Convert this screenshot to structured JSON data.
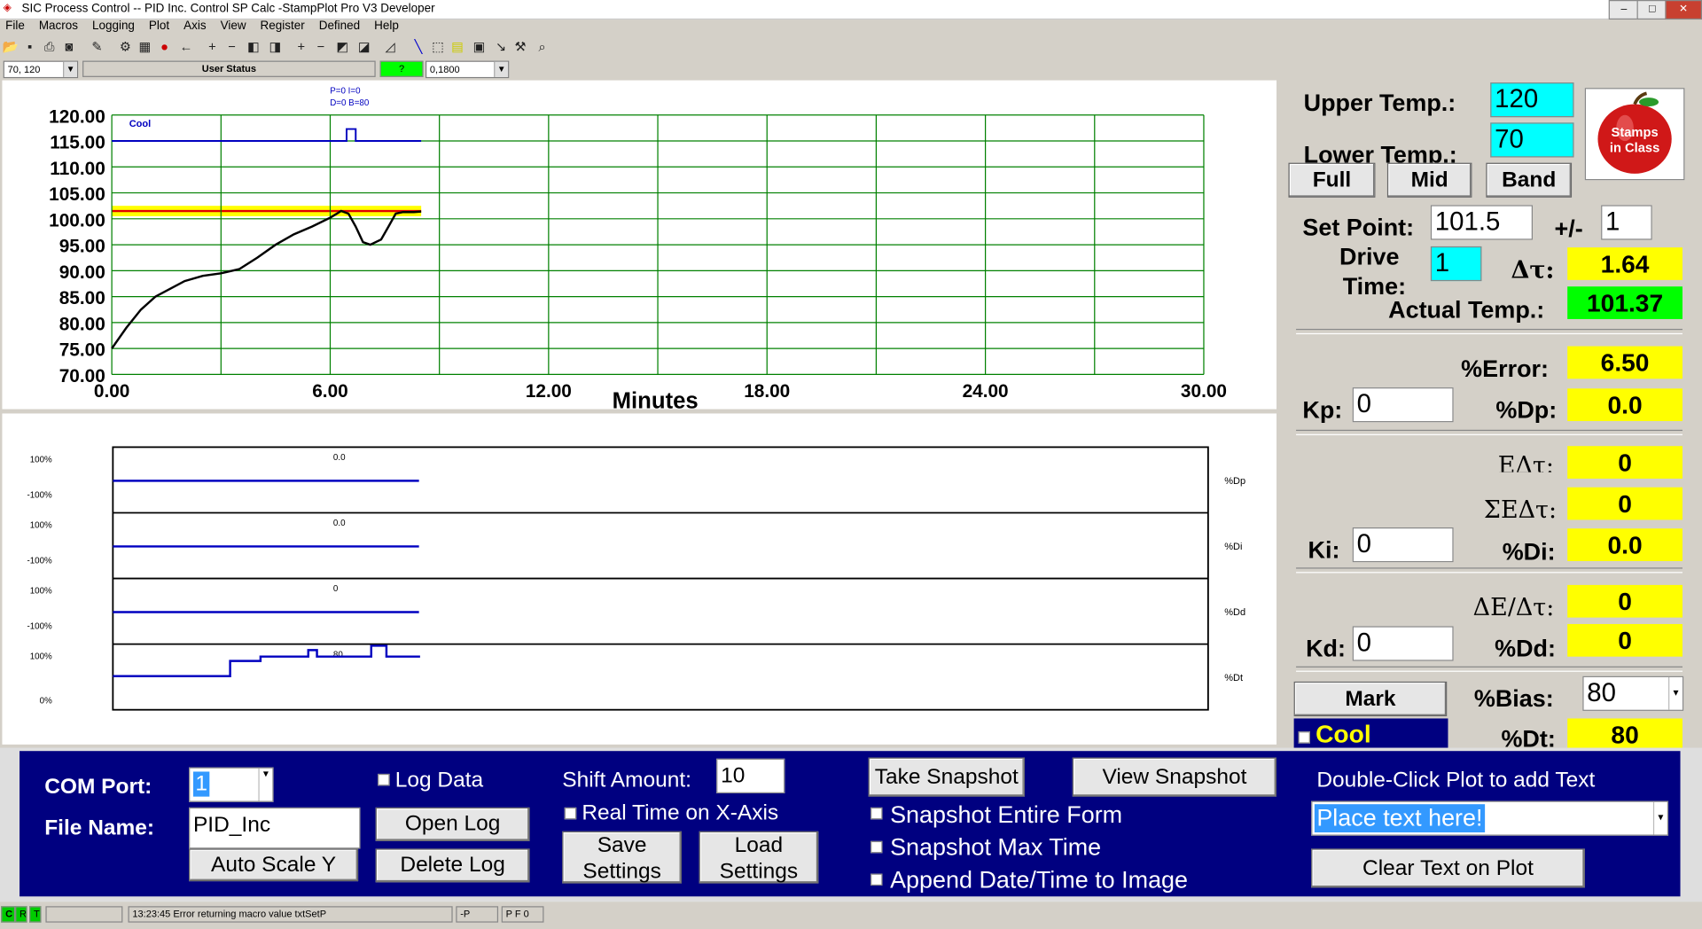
{
  "window": {
    "title": "SIC Process Control -- PID Inc. Control SP Calc -StampPlot Pro V3 Developer"
  },
  "menu": [
    "File",
    "Macros",
    "Logging",
    "Plot",
    "Axis",
    "View",
    "Register",
    "Defined",
    "Help"
  ],
  "toolbar2": {
    "coords": "70, 120",
    "user_status": "User Status",
    "indicator": "?",
    "zoom_value": "0,1800"
  },
  "colors": {
    "panel_blue": "#000080",
    "cyan": "#00ffff",
    "yellow": "#ffff00",
    "green": "#00ff00",
    "grid": "#008000"
  },
  "top_plot": {
    "legend_pid": "P=0 I=0",
    "legend_db": "D=0 B=80",
    "cool_label": "Cool",
    "xlabel": "Minutes"
  },
  "bottom_plot": {
    "rows": [
      {
        "top_pct": "100%",
        "bot_pct": "-100%",
        "value": "0.0",
        "name": "%Dp"
      },
      {
        "top_pct": "100%",
        "bot_pct": "-100%",
        "value": "0.0",
        "name": "%Di"
      },
      {
        "top_pct": "100%",
        "bot_pct": "-100%",
        "value": "0",
        "name": "%Dd"
      },
      {
        "top_pct": "100%",
        "bot_pct": "0%",
        "value": "80",
        "name": "%Dt"
      }
    ]
  },
  "chart_data": {
    "type": "line",
    "title": "",
    "xlabel": "Minutes",
    "ylabel": "",
    "xlim": [
      0,
      30
    ],
    "ylim": [
      70,
      120
    ],
    "x_ticks": [
      "0.00",
      "6.00",
      "12.00",
      "18.00",
      "24.00",
      "30.00"
    ],
    "y_ticks": [
      "120.00",
      "115.00",
      "110.00",
      "105.00",
      "100.00",
      "95.00",
      "90.00",
      "85.00",
      "80.00",
      "75.00",
      "70.00"
    ],
    "grid": true,
    "band": {
      "center": 101.5,
      "low": 100.5,
      "high": 102.5
    },
    "series": [
      {
        "name": "Temp",
        "color": "#000000",
        "x": [
          0,
          0.4,
          0.8,
          1.2,
          1.6,
          2.0,
          2.5,
          3.0,
          3.5,
          4.0,
          4.5,
          5.0,
          5.5,
          6.0,
          6.3,
          6.5,
          6.7,
          6.9,
          7.1,
          7.4,
          7.6,
          7.8,
          8.0,
          8.3,
          8.5
        ],
        "y": [
          75,
          79,
          82.5,
          85,
          86.5,
          88,
          89,
          89.5,
          90.3,
          92.5,
          95,
          97,
          98.5,
          100.2,
          101.5,
          101,
          98.5,
          95.5,
          95,
          96,
          98.5,
          101,
          101.3,
          101.3,
          101.4
        ]
      },
      {
        "name": "Cool",
        "color": "#0000c0",
        "x": [
          0,
          6.45,
          6.45,
          6.7,
          6.7,
          8.5
        ],
        "y": [
          115,
          115,
          117.3,
          117.3,
          115,
          115
        ]
      }
    ]
  },
  "panel": {
    "upper_temp_label": "Upper Temp.:",
    "upper_temp": "120",
    "lower_temp_label": "Lower Temp.:",
    "lower_temp": "70",
    "btn_full": "Full",
    "btn_mid": "Mid",
    "btn_band": "Band",
    "logo_text": "Stamps in Class",
    "set_point_label": "Set Point:",
    "set_point": "101.5",
    "pm_label": "+/-",
    "pm_value": "1",
    "drive_label": "Drive",
    "time_label": "Time:",
    "drive_time": "1",
    "dt_label": "Δτ:",
    "dt_value": "1.64",
    "actual_label": "Actual Temp.:",
    "actual_value": "101.37",
    "error_label": "%Error:",
    "error_value": "6.50",
    "kp_label": "Kp:",
    "kp_value": "0",
    "dp_label": "%Dp:",
    "dp_value": "0.0",
    "edt_label": "EΔτ:",
    "edt_value": "0",
    "sedt_label": "ΣEΔτ:",
    "sedt_value": "0",
    "ki_label": "Ki:",
    "ki_value": "0",
    "di_label": "%Di:",
    "di_value": "0.0",
    "dedt_label": "ΔE/Δτ:",
    "dedt_value": "0",
    "kd_label": "Kd:",
    "kd_value": "0",
    "dd_label": "%Dd:",
    "dd_value": "0",
    "mark_btn": "Mark",
    "bias_label": "%Bias:",
    "bias_value": "80",
    "cool_label": "Cool",
    "dtot_label": "%Dt:",
    "dtot_value": "80"
  },
  "bottom": {
    "com_label": "COM Port:",
    "com_value": "1",
    "file_label": "File Name:",
    "file_value": "PID_Inc",
    "autoscale_btn": "Auto Scale Y",
    "log_data": "Log Data",
    "open_log": "Open Log",
    "delete_log": "Delete Log",
    "shift_label": "Shift Amount:",
    "shift_value": "10",
    "realtime": "Real Time on X-Axis",
    "save_settings": "Save Settings",
    "load_settings": "Load Settings",
    "take_snapshot": "Take Snapshot",
    "view_snapshot": "View Snapshot",
    "snap_entire": "Snapshot Entire Form",
    "snap_max": "Snapshot Max Time",
    "append_date": "Append Date/Time to Image",
    "dbl_click": "Double-Click Plot to add Text",
    "place_text": "Place text here!",
    "clear_text": "Clear Text on Plot"
  },
  "status": {
    "msg": "13:23:45 Error returning macro value txtSetP",
    "p": "-P",
    "pf": "P F 0"
  }
}
